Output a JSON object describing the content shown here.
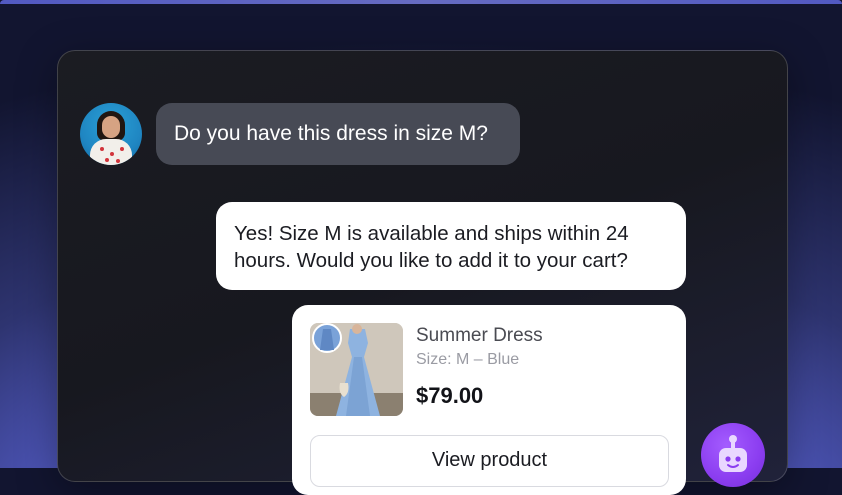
{
  "messages": [
    {
      "role": "user",
      "text": "Do you have this dress in size M?"
    },
    {
      "role": "assistant",
      "text": "Yes! Size M is available and ships within 24 hours. Would you like to add it to your cart?"
    }
  ],
  "product": {
    "name": "Summer Dress",
    "variant": "Size: M – Blue",
    "price": "$79.00",
    "button_label": "View product"
  },
  "colors": {
    "user_bubble": "#474a55",
    "assistant_bubble": "#ffffff",
    "bot_accent": "#8b3df0",
    "background_accent": "#7c86ff"
  },
  "icons": {
    "user_avatar": "user-avatar-photo",
    "bot_avatar": "robot-icon"
  }
}
